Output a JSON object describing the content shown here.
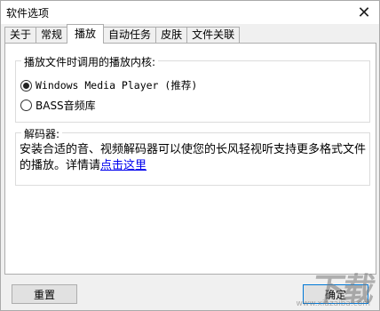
{
  "window": {
    "title": "软件选项",
    "close_glyph": "✕"
  },
  "tabs": [
    {
      "label": "关于",
      "active": false
    },
    {
      "label": "常规",
      "active": false
    },
    {
      "label": "播放",
      "active": true
    },
    {
      "label": "自动任务",
      "active": false
    },
    {
      "label": "皮肤",
      "active": false
    },
    {
      "label": "文件关联",
      "active": false
    }
  ],
  "play_core": {
    "group_title": "播放文件时调用的播放内核:",
    "options": [
      {
        "label": "Windows Media Player (推荐)",
        "checked": true
      },
      {
        "label": "BASS音频库",
        "checked": false
      }
    ]
  },
  "decoder": {
    "group_title": "解码器:",
    "description": "安装合适的音、视频解码器可以使您的长风轻视听支持更多格式文件的播放。详情请",
    "link_text": "点击这里"
  },
  "buttons": {
    "reset": "重置",
    "ok": "确定"
  },
  "watermark": {
    "logo": "下载吧",
    "url": "www.xiazaiba.com"
  }
}
